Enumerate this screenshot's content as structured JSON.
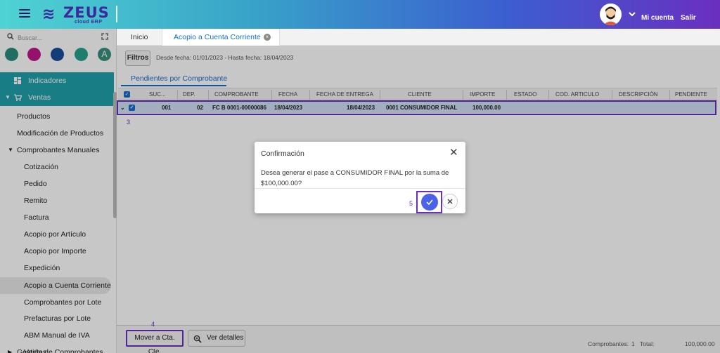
{
  "header": {
    "logo_text": "ZEUS",
    "logo_sub": "cloud ERP",
    "account_label": "Mi cuenta",
    "logout_label": "Salir"
  },
  "sidebar": {
    "search_placeholder": "Buscar...",
    "dots": [
      "#2a8c7d",
      "#c0178a",
      "#1a4f9a",
      "#28a08a",
      "#3a8f7f"
    ],
    "dot_letter": "A",
    "items": [
      {
        "label": "Indicadores"
      },
      {
        "label": "Ventas"
      },
      {
        "label": "Productos"
      },
      {
        "label": "Modificación de Productos"
      },
      {
        "label": "Comprobantes Manuales"
      },
      {
        "label": "Cotización"
      },
      {
        "label": "Pedido"
      },
      {
        "label": "Remito"
      },
      {
        "label": "Factura"
      },
      {
        "label": "Acopio por Artículo"
      },
      {
        "label": "Acopio por Importe"
      },
      {
        "label": "Expedición"
      },
      {
        "label": "Acopio a Cuenta Corriente"
      },
      {
        "label": "Comprobantes por Lote"
      },
      {
        "label": "Prefacturas por Lote"
      },
      {
        "label": "ABM Manual de IVA Ventas"
      },
      {
        "label": "Gestión de Comprobantes"
      }
    ]
  },
  "tabs": [
    {
      "label": "Inicio"
    },
    {
      "label": "Acopio a Cuenta Corriente"
    }
  ],
  "filters": {
    "button_label": "Filtros",
    "summary": "Desde fecha: 01/01/2023 - Hasta fecha: 18/04/2023"
  },
  "subtab": "Pendientes por Comprobante",
  "grid": {
    "columns": [
      "SUC...",
      "DEP.",
      "COMPROBANTE",
      "FECHA",
      "FECHA DE ENTREGA",
      "CLIENTE",
      "IMPORTE",
      "ESTADO",
      "COD. ARTICULO",
      "DESCRIPCIÓN",
      "PENDIENTE"
    ],
    "row": {
      "suc": "001",
      "dep": "02",
      "comprobante": "FC B 0001-00000086",
      "fecha": "18/04/2023",
      "fecha_entrega": "18/04/2023",
      "cliente": "0001 CONSUMIDOR FINAL",
      "importe": "100,000.00"
    }
  },
  "markers": {
    "row": "3",
    "move_button": "4",
    "ok_button": "5"
  },
  "dialog": {
    "title": "Confirmación",
    "message_line1": "Desea generar el pase a CONSUMIDOR FINAL por la suma de",
    "message_line2": "$100,000.00?"
  },
  "footer": {
    "move_label": "Mover a Cta. Cte.",
    "details_label": "Ver detalles",
    "count_label": "Comprobantes:",
    "count_value": "1",
    "total_label": "Total:",
    "total_value": "100,000.00"
  },
  "colors": {
    "accent": "#1a6dd0",
    "highlight": "#6a2fc0",
    "sidebar_active": "#1fa0a9"
  }
}
